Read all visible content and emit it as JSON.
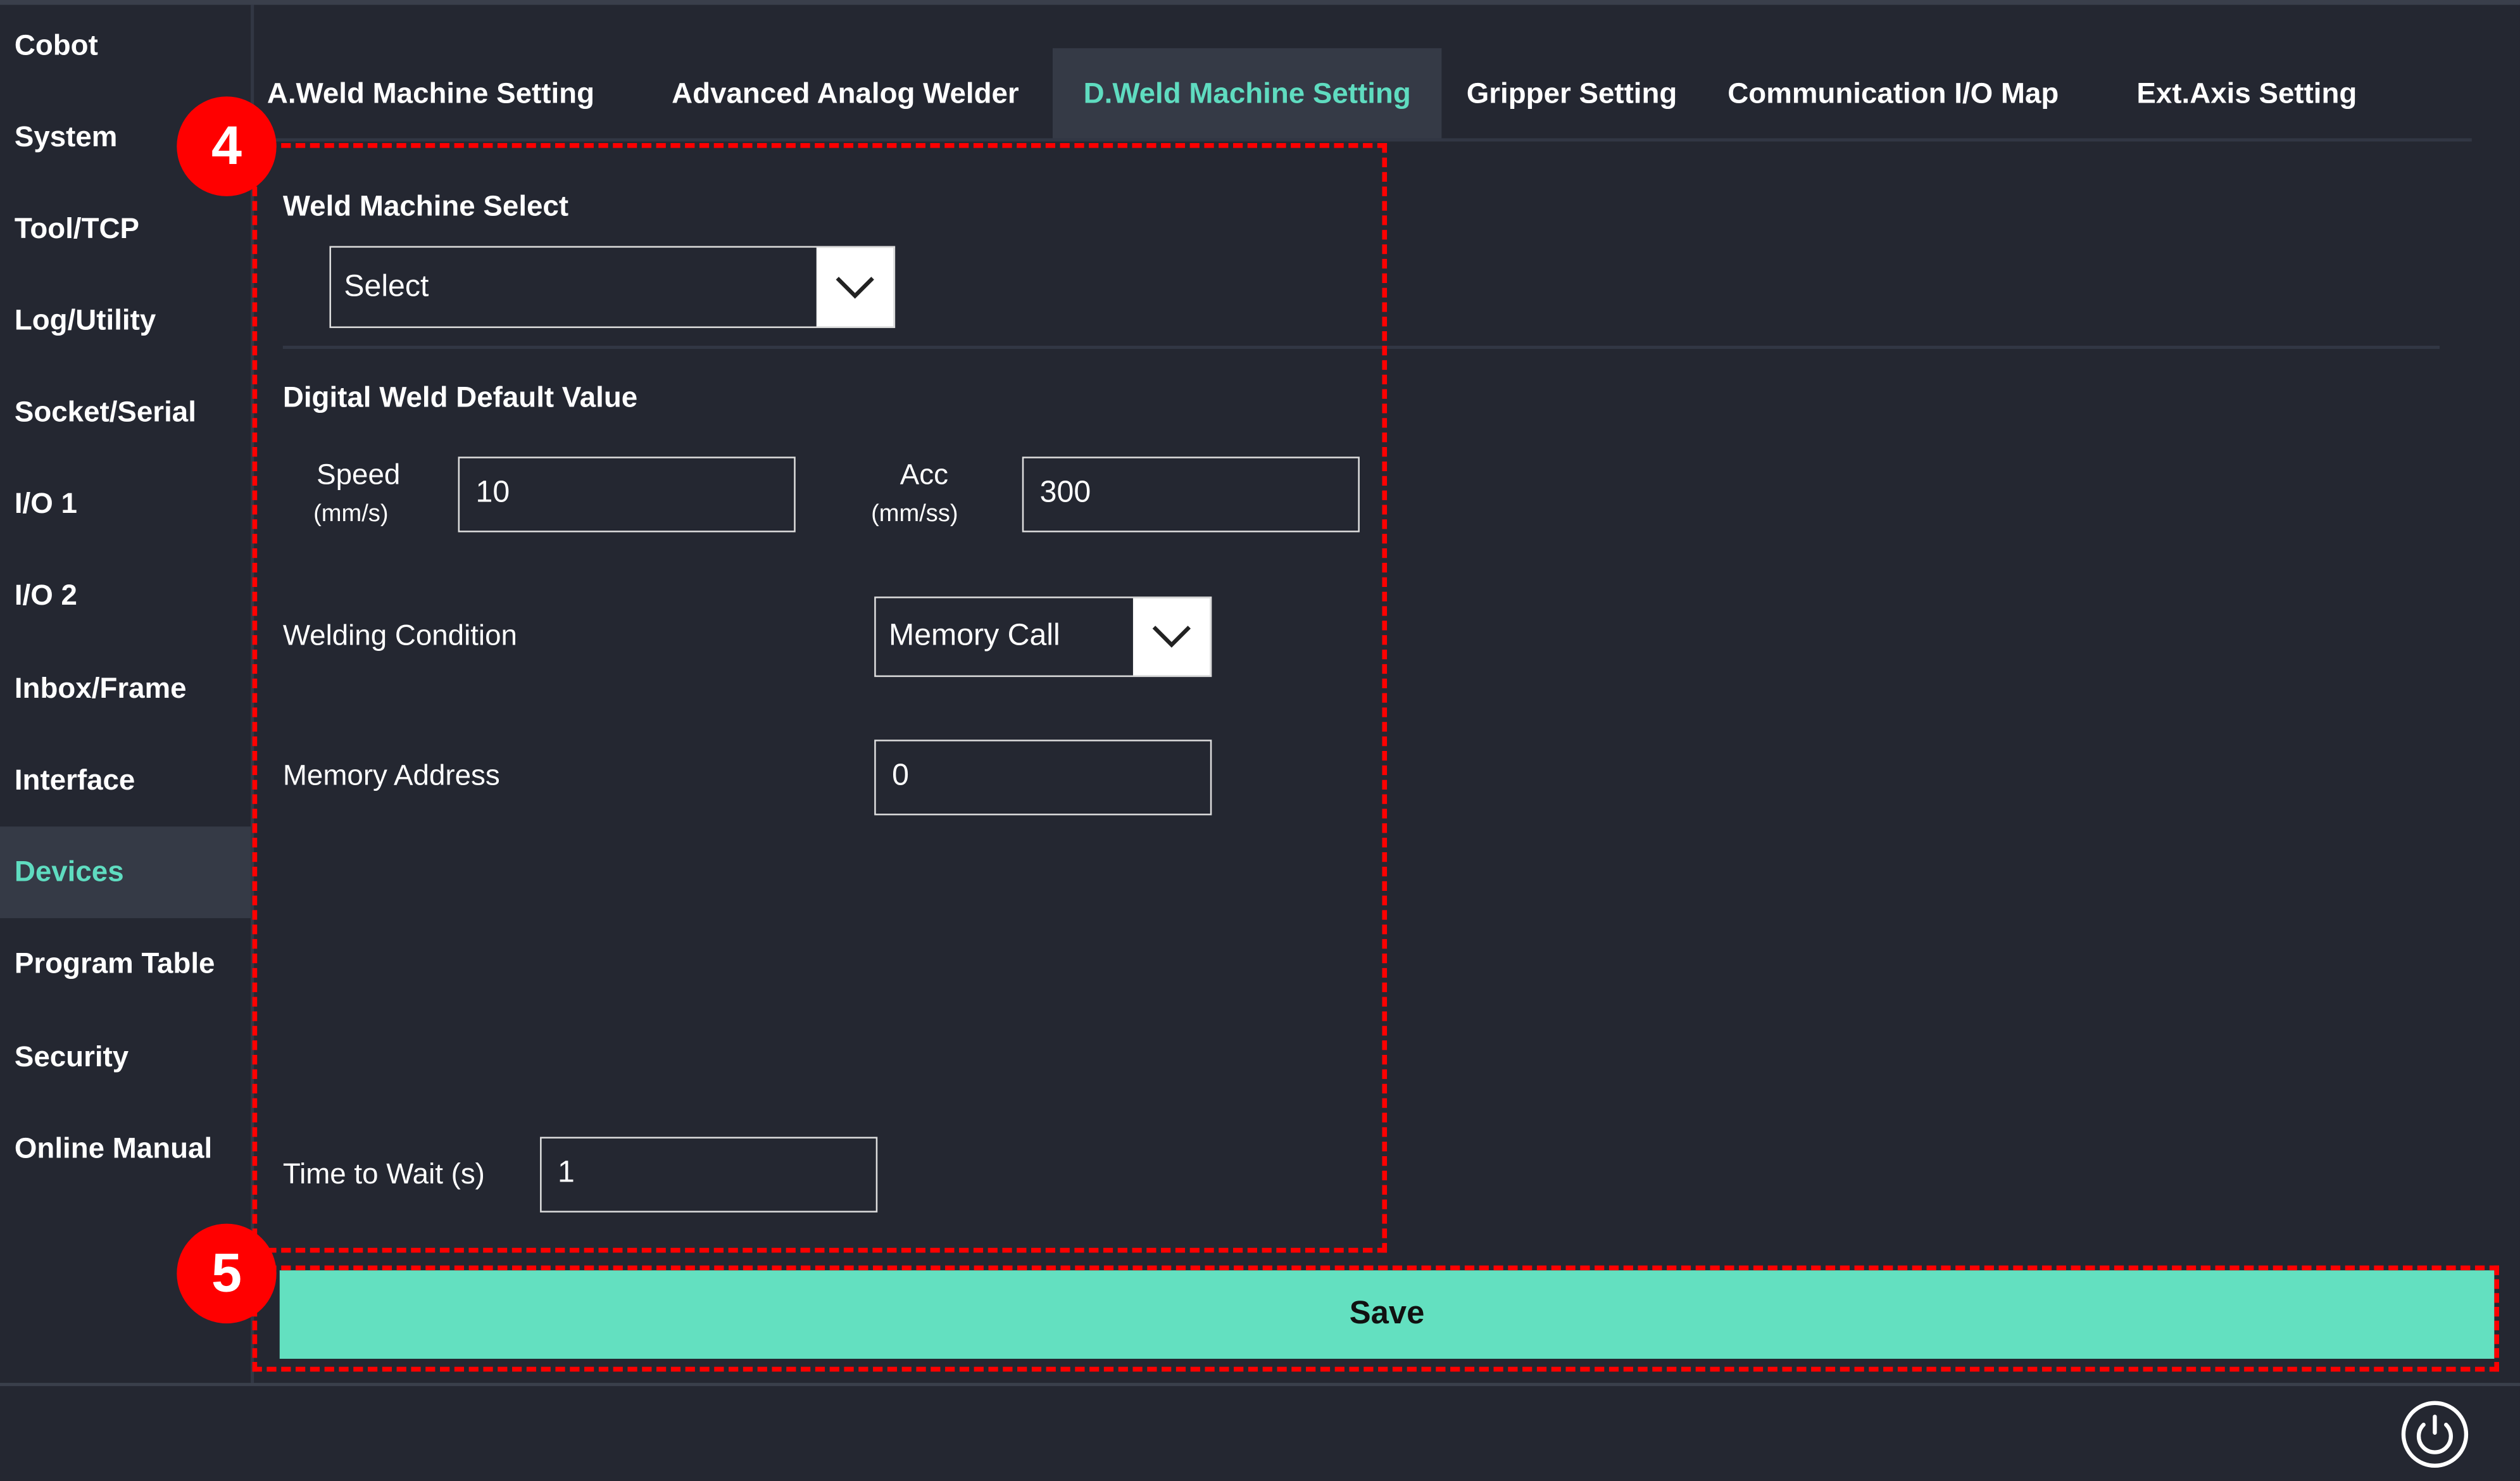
{
  "sidebar": {
    "items": [
      {
        "label": "Cobot"
      },
      {
        "label": "System"
      },
      {
        "label": "Tool/TCP"
      },
      {
        "label": "Log/Utility"
      },
      {
        "label": "Socket/Serial"
      },
      {
        "label": "I/O 1"
      },
      {
        "label": "I/O 2"
      },
      {
        "label": "Inbox/Frame"
      },
      {
        "label": "Interface"
      },
      {
        "label": "Devices",
        "active": true
      },
      {
        "label": "Program Table"
      },
      {
        "label": "Security"
      },
      {
        "label": "Online Manual"
      }
    ]
  },
  "tabs": [
    {
      "label": "A.Weld Machine Setting"
    },
    {
      "label": "Advanced Analog Welder"
    },
    {
      "label": "D.Weld Machine Setting",
      "active": true
    },
    {
      "label": "Gripper Setting"
    },
    {
      "label": "Communication I/O Map"
    },
    {
      "label": "Ext.Axis Setting"
    }
  ],
  "form": {
    "weld_machine_select_label": "Weld Machine Select",
    "weld_machine_select_value": "Select",
    "default_value_title": "Digital Weld Default Value",
    "speed_label": "Speed",
    "speed_unit": "(mm/s)",
    "speed_value": "10",
    "acc_label": "Acc",
    "acc_unit": "(mm/ss)",
    "acc_value": "300",
    "welding_condition_label": "Welding Condition",
    "welding_condition_value": "Memory Call",
    "memory_address_label": "Memory Address",
    "memory_address_value": "0",
    "time_to_wait_label": "Time to Wait (s)",
    "time_to_wait_value": "1"
  },
  "save_label": "Save",
  "annotations": {
    "badge4": "4",
    "badge5": "5"
  },
  "colors": {
    "accent": "#63e0c0",
    "background": "#242731",
    "annotation": "#ff0000"
  }
}
